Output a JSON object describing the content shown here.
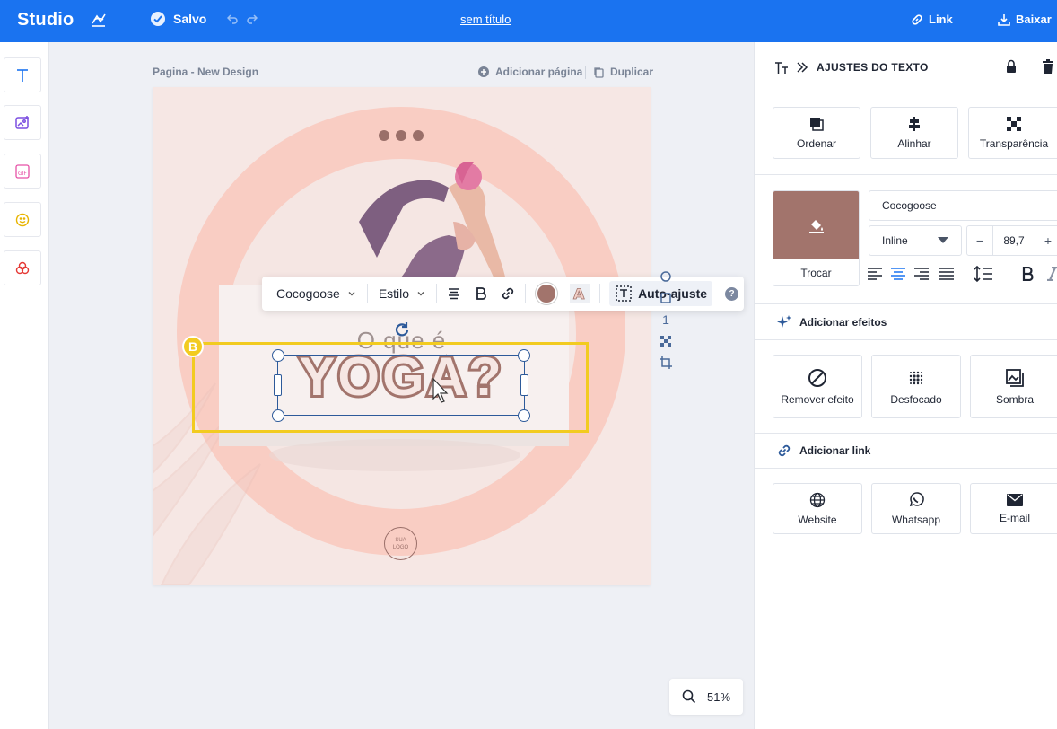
{
  "topbar": {
    "brand": "Studio",
    "saved": "Salvo",
    "title": "sem título",
    "link": "Link",
    "download": "Baixar"
  },
  "left_tools": [
    "text-icon",
    "image-plus-icon",
    "gif-icon",
    "smiley-icon",
    "shapes-icon"
  ],
  "canvas": {
    "page_label": "Pagina - New Design",
    "add_page": "Adicionar página",
    "duplicate": "Duplicar",
    "pre_text": "O que é",
    "main_text": "YOGA?",
    "logo_line1": "SUA",
    "logo_line2": "LOGO",
    "side_number": "1",
    "badge": "B"
  },
  "text_toolbar": {
    "font": "Cocogoose",
    "style": "Estilo",
    "autofit": "Auto-ajuste",
    "help": "?"
  },
  "zoom": {
    "value": "51%"
  },
  "right_panel": {
    "title": "AJUSTES DO TEXTO",
    "arrange": [
      "Ordenar",
      "Alinhar",
      "Transparência"
    ],
    "swap": "Trocar",
    "font_name": "Cocogoose",
    "display_mode": "Inline",
    "font_size": "89,7",
    "minus": "−",
    "plus": "+",
    "effects_title": "Adicionar efeitos",
    "effects": [
      "Remover efeito",
      "Desfocado",
      "Sombra"
    ],
    "link_title": "Adicionar link",
    "links": [
      "Website",
      "Whatsapp",
      "E-mail"
    ]
  },
  "colors": {
    "accent": "#1a73f0",
    "text_color": "#a2746c",
    "selection": "#f2cb20",
    "page_bg": "#f6e7e4"
  }
}
